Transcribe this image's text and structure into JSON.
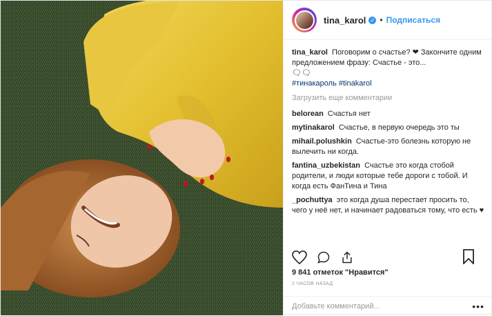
{
  "post": {
    "username": "tina_karol",
    "verified_mark": "●",
    "separator": "•",
    "follow_label": "Подписаться",
    "caption_user": "tina_karol",
    "caption_text": "Поговорим о счастье? ❤ Закончите одним предложением фразу: Счастье - это...",
    "caption_emoji": "🗨🗨",
    "hashtags": "#тинакароль #tinakarol",
    "load_more": "Загрузить еще комментарии",
    "comments": [
      {
        "user": "belorean",
        "text": "Счастья нет"
      },
      {
        "user": "mytinakarol",
        "text": "Счастье, в первую очередь это ты"
      },
      {
        "user": "mihail.polushkin",
        "text": "Счастье-это болезнь которую не вылечить ни когда."
      },
      {
        "user": "fantina_uzbekistan",
        "text": "Счастье это когда стобой родители, и люди которые тебе дороги с тобой. И когда есть ФанТина и Тина"
      },
      {
        "user": "_pochuttya",
        "text": "это когда душа перестает просить то, чего у неё нет, и начинает радоваться тому, что есть ♥"
      }
    ],
    "likes_count": "9 841",
    "likes_label": "отметок \"Нравится\"",
    "time_ago": "2 ЧАСОВ НАЗАД",
    "add_comment_placeholder": "Добавьте комментарий...",
    "more_dots": "•••"
  },
  "icons": [
    "heart-icon",
    "comment-icon",
    "share-icon",
    "bookmark-icon",
    "more-icon"
  ],
  "colors": {
    "accent": "#3897f0",
    "text": "#262626",
    "muted": "#999999",
    "dress": "#e5c43b",
    "grass": "#3a4d2a"
  }
}
